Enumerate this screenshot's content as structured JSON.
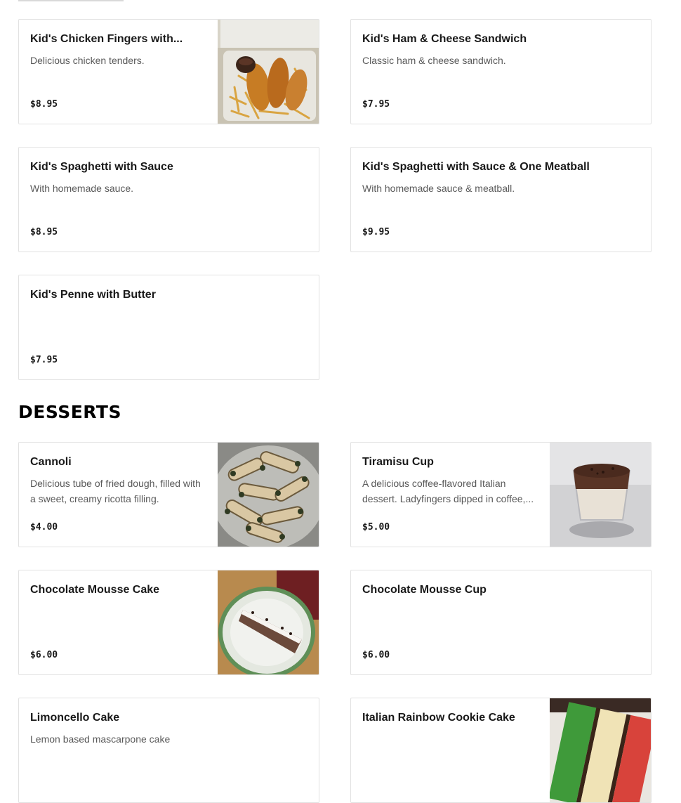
{
  "kids_items": [
    {
      "name": "Kid's Chicken Fingers with...",
      "description": "Delicious chicken tenders.",
      "price": "$8.95"
    },
    {
      "name": "Kid's Ham & Cheese Sandwich",
      "description": "Classic ham & cheese sandwich.",
      "price": "$7.95"
    },
    {
      "name": "Kid's Spaghetti with Sauce",
      "description": "With homemade sauce.",
      "price": "$8.95"
    },
    {
      "name": "Kid's Spaghetti with Sauce & One Meatball",
      "description": "With homemade sauce & meatball.",
      "price": "$9.95"
    },
    {
      "name": "Kid's Penne with Butter",
      "description": "",
      "price": "$7.95"
    }
  ],
  "desserts": {
    "title": "DESSERTS",
    "items": [
      {
        "name": "Cannoli",
        "description": "Delicious tube of fried dough, filled with a sweet, creamy ricotta filling.",
        "price": "$4.00"
      },
      {
        "name": "Tiramisu Cup",
        "description": "A delicious coffee-flavored Italian dessert. Ladyfingers dipped in coffee,...",
        "price": "$5.00"
      },
      {
        "name": "Chocolate Mousse Cake",
        "description": "",
        "price": "$6.00"
      },
      {
        "name": "Chocolate Mousse Cup",
        "description": "",
        "price": "$6.00"
      },
      {
        "name": "Limoncello Cake",
        "description": "Lemon based mascarpone cake",
        "price": ""
      },
      {
        "name": "Italian Rainbow Cookie Cake",
        "description": "",
        "price": ""
      }
    ]
  }
}
